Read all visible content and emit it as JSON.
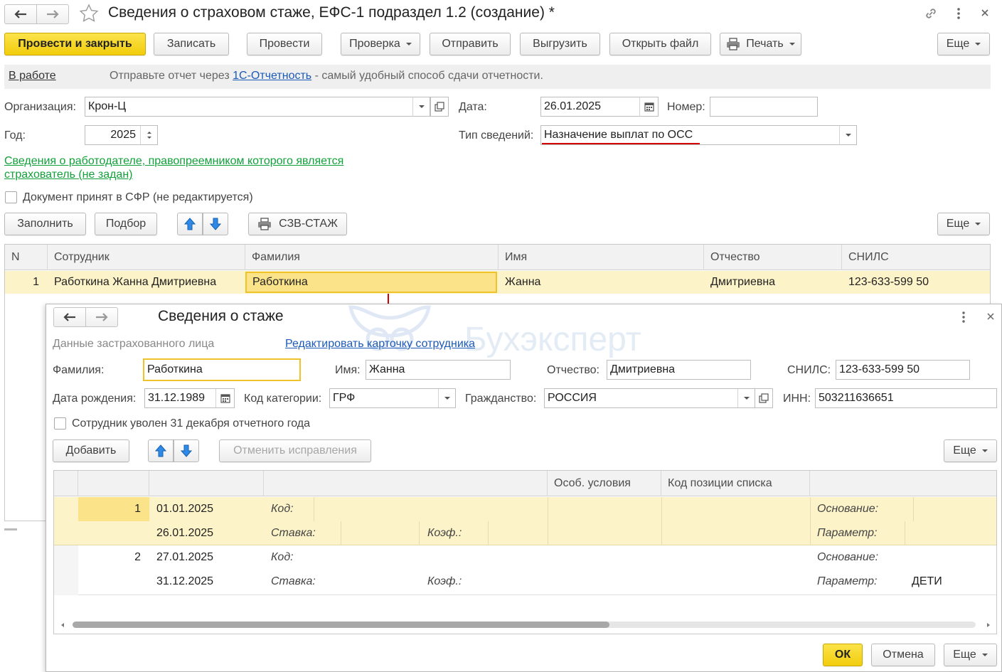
{
  "window": {
    "title": "Сведения о страховом стаже, ЕФС-1 подраздел 1.2 (создание) *"
  },
  "toolbar": {
    "post_close": "Провести и закрыть",
    "save": "Записать",
    "post": "Провести",
    "check": "Проверка",
    "send": "Отправить",
    "export": "Выгрузить",
    "open_file": "Открыть файл",
    "print": "Печать",
    "more": "Еще"
  },
  "status_bar": {
    "status": "В работе",
    "message_prefix": "Отправьте отчет через",
    "link": "1С-Отчетность",
    "message_suffix": "- самый удобный способ сдачи отчетности."
  },
  "form": {
    "org_label": "Организация:",
    "org_value": "Крон-Ц",
    "date_label": "Дата:",
    "date_value": "26.01.2025",
    "number_label": "Номер:",
    "number_value": "",
    "year_label": "Год:",
    "year_value": "2025",
    "type_label": "Тип сведений:",
    "type_value": "Назначение выплат по ОСС",
    "employer_link_line1": "Сведения о работодателе, правопреемником которого является",
    "employer_link_line2": "страхователь (не задан)",
    "accepted_label": "Документ принят в СФР (не редактируется)"
  },
  "table_toolbar": {
    "fill": "Заполнить",
    "select": "Подбор",
    "szv": "СЗВ-СТАЖ",
    "more": "Еще"
  },
  "main_table": {
    "headers": [
      "N",
      "Сотрудник",
      "Фамилия",
      "Имя",
      "Отчество",
      "СНИЛС"
    ],
    "rows": [
      [
        "1",
        "Работкина Жанна Дмитриевна",
        "Работкина",
        "Жанна",
        "Дмитриевна",
        "123-633-599 50"
      ]
    ]
  },
  "dialog": {
    "title": "Сведения о стаже",
    "watermark": "Бухэксперт",
    "section_label": "Данные застрахованного лица",
    "edit_card_link": "Редактировать карточку сотрудника",
    "surname_label": "Фамилия:",
    "surname_value": "Работкина",
    "name_label": "Имя:",
    "name_value": "Жанна",
    "patronymic_label": "Отчество:",
    "patronymic_value": "Дмитриевна",
    "snils_label": "СНИЛС:",
    "snils_value": "123-633-599 50",
    "birth_label": "Дата рождения:",
    "birth_value": "31.12.1989",
    "category_label": "Код категории:",
    "category_value": "ГРФ",
    "citizenship_label": "Гражданство:",
    "citizenship_value": "РОССИЯ",
    "inn_label": "ИНН:",
    "inn_value": "503211636651",
    "dismissed_label": "Сотрудник уволен 31 декабря отчетного года",
    "add": "Добавить",
    "cancel_fix": "Отменить исправления",
    "more": "Еще",
    "table_headers": {
      "special": "Особ. условия",
      "position_code": "Код позиции списка"
    },
    "rows": [
      {
        "n": "1",
        "start": "01.01.2025",
        "end": "26.01.2025",
        "code_label": "Код:",
        "rate_label": "Ставка:",
        "coef_label": "Коэф.:",
        "basis_label": "Основание:",
        "param_label": "Параметр:",
        "param_value": ""
      },
      {
        "n": "2",
        "start": "27.01.2025",
        "end": "31.12.2025",
        "code_label": "Код:",
        "rate_label": "Ставка:",
        "coef_label": "Коэф.:",
        "basis_label": "Основание:",
        "param_label": "Параметр:",
        "param_value": "ДЕТИ"
      }
    ],
    "ok": "ОК",
    "cancel": "Отмена",
    "more_bottom": "Еще"
  },
  "colors": {
    "primary_button": "#f5d21c",
    "selected_row": "#fdf3c8",
    "active_cell": "#fbe38a",
    "link": "#1c5ab8",
    "green_link": "#12a03a",
    "annotation": "#d40000"
  }
}
